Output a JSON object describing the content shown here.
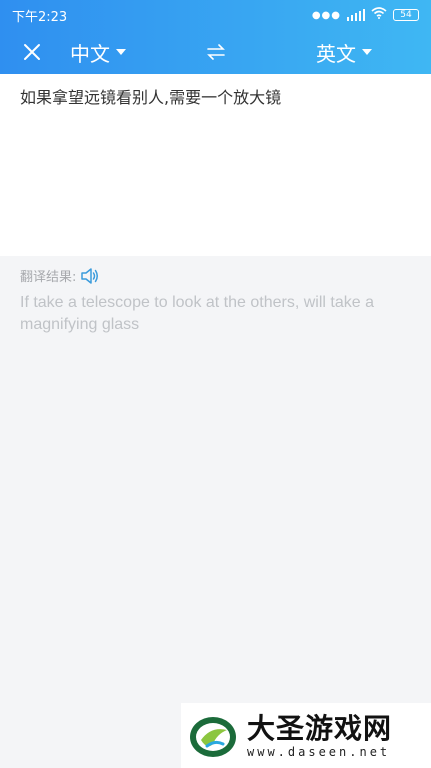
{
  "status_bar": {
    "time": "下午2:23",
    "battery": "54"
  },
  "toolbar": {
    "close_icon": "close-icon",
    "source_language": "中文",
    "swap_icon": "swap-arrows-icon",
    "target_language": "英文"
  },
  "input": {
    "text": "如果拿望远镜看别人,需要一个放大镜"
  },
  "result": {
    "label": "翻译结果:",
    "speaker_icon": "speaker-icon",
    "text": "If take a telescope to look at the others, will take a magnifying glass"
  },
  "watermark": {
    "title": "大圣游戏网",
    "url": "www.daseen.net"
  },
  "colors": {
    "header_start": "#2f8ff0",
    "header_end": "#3fb7f3",
    "result_text": "#c0c3c7",
    "speaker": "#3a9bdc"
  }
}
